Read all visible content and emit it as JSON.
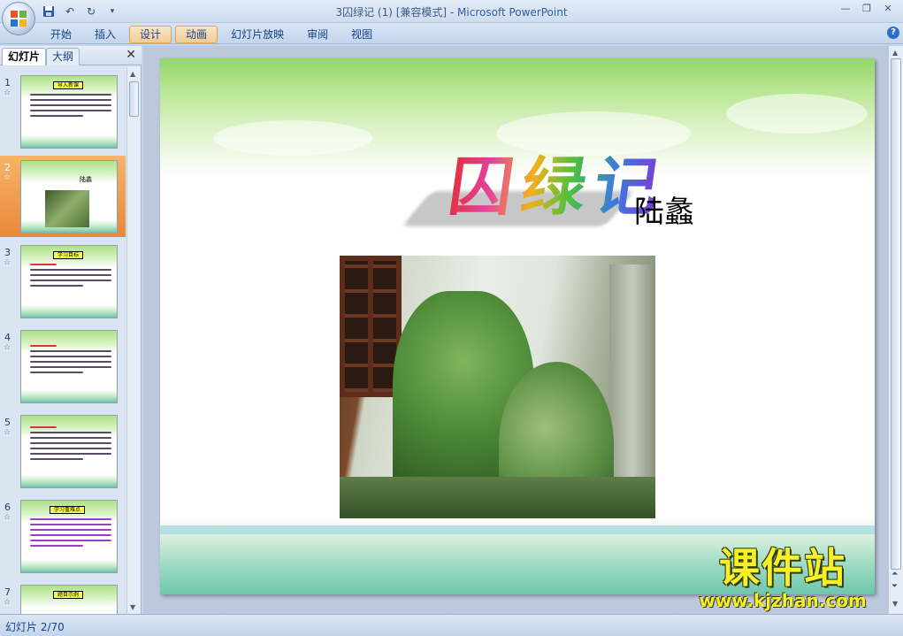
{
  "window": {
    "title": "3囚绿记 (1) [兼容模式] - ",
    "app_name": "Microsoft PowerPoint"
  },
  "quick_access": {
    "save_icon": "save-icon",
    "undo_icon": "undo-icon",
    "redo_icon": "redo-icon"
  },
  "ribbon": {
    "tabs": [
      {
        "label": "开始"
      },
      {
        "label": "插入"
      },
      {
        "label": "设计"
      },
      {
        "label": "动画"
      },
      {
        "label": "幻灯片放映"
      },
      {
        "label": "审阅"
      },
      {
        "label": "视图"
      }
    ]
  },
  "pane": {
    "tab_slides": "幻灯片",
    "tab_outline": "大纲",
    "close": "✕"
  },
  "thumbnails": [
    {
      "num": "1",
      "title": "导入新课"
    },
    {
      "num": "2",
      "title": "陆蠡"
    },
    {
      "num": "3",
      "title": "学习目标"
    },
    {
      "num": "4",
      "title": ""
    },
    {
      "num": "5",
      "title": ""
    },
    {
      "num": "6",
      "title": "学习重难点"
    },
    {
      "num": "7",
      "title": "题目示例"
    }
  ],
  "slide": {
    "title": "囚绿记",
    "author": "陆蠡",
    "watermark_main": "课件站",
    "watermark_url": "www.kjzhan.com"
  },
  "status": {
    "slide_counter": "幻灯片 2/70"
  },
  "colors": {
    "selected_tab": "#f2cd93",
    "selected_thumb": "#e9883a",
    "watermark": "#f7ef2a"
  }
}
